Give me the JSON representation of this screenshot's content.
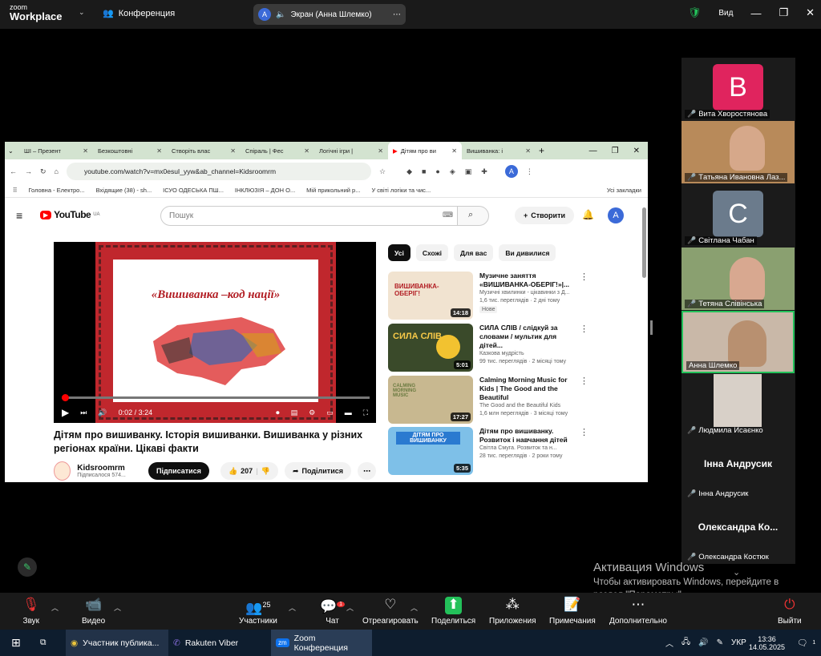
{
  "zoom_top": {
    "logo_top": "zoom",
    "logo_bottom": "Workplace",
    "meeting_label": "Конференция",
    "share_avatar": "A",
    "share_label": "Экран (Анна Шлемко)",
    "view_label": "Вид"
  },
  "browser": {
    "tabs": [
      "ШІ – Презент",
      "Безкоштовні",
      "Створіть влас",
      "Спіраль | Фес",
      "Логічні ігри |",
      "Дітям про ви",
      "Вишиванка: і"
    ],
    "active_tab_index": 5,
    "url": "youtube.com/watch?v=mx0esuI_yyw&ab_channel=Kidsroomrm",
    "bookmarks": [
      "Головна - Електро...",
      "Вхідящие (38) - sh...",
      "ІСУО ОДЕСЬКА ПШ...",
      "ІНКЛЮЗІЯ – ДОН О...",
      "Мій прикольний р...",
      "У світі логіки та чис..."
    ],
    "all_bookmarks": "Усі закладки",
    "profile_letter": "A"
  },
  "youtube": {
    "logo": "YouTube",
    "region": "UA",
    "search_placeholder": "Пошук",
    "create_label": "Створити",
    "avatar_letter": "A",
    "thumbnail_title": "«Вишиванка –код нації»",
    "time_current": "0:02",
    "time_total": "3:24",
    "progress": 0.01,
    "video_title": "Дітям про вишиванку. Історія вишиванки. Вишиванка у різних регіонах країни. Цікаві факти",
    "channel_name": "Kidsroomrm",
    "channel_subs": "Підписалося 574...",
    "subscribe_label": "Підписатися",
    "likes": "207",
    "share_label": "Поділитися",
    "chips": [
      "Усі",
      "Схожі",
      "Для вас",
      "Ви дивилися"
    ],
    "recommendations": [
      {
        "title": "Музичне заняття «ВИШИВАНКА-ОБЕРІГ!»|...",
        "channel": "Музичні хвилинки - цікавинки з Д...",
        "meta": "1,6 тис. переглядів · 2 дні тому",
        "badge": "Нове",
        "duration": "14:18",
        "thumb_text": "ВИШИВАНКА-ОБЕРІГ!",
        "color": "#f1e3d0"
      },
      {
        "title": "СИЛА СЛІВ / слідкуй за словами / мультик для дітей...",
        "channel": "Казкова мудрість",
        "meta": "99 тис. переглядів · 2 місяці тому",
        "badge": "",
        "duration": "5:01",
        "thumb_text": "СИЛА СЛІВ",
        "color": "#3a4a2a"
      },
      {
        "title": "Calming Morning Music for Kids | The Good and the Beautiful",
        "channel": "The Good and the Beautiful Kids",
        "meta": "1,6 млн переглядів · 3 місяці тому",
        "badge": "",
        "duration": "17:27",
        "thumb_text": "CALMING MORNING MUSIC",
        "color": "#c8b890"
      },
      {
        "title": "Дітям про вишиванку. Розвиток і навчання дітей",
        "channel": "Світла Смуга. Розвиток та н...",
        "meta": "28 тис. переглядів · 2 роки тому",
        "badge": "",
        "duration": "5:35",
        "thumb_text": "ДІТЯМ ПРО ВИШИВАНКУ",
        "color": "#7ec0e8"
      }
    ]
  },
  "participants": [
    {
      "name": "Вита Хворостянова",
      "type": "letter",
      "letter": "B",
      "color": "#e0245e"
    },
    {
      "name": "Тaтьяна Ивановна Лаз...",
      "type": "video",
      "color": "#b88a5a"
    },
    {
      "name": "Світлана Чабан",
      "type": "letter",
      "letter": "C",
      "color": "#6b7b8c"
    },
    {
      "name": "Тетяна Слівінська",
      "type": "video",
      "color": "#8aa070"
    },
    {
      "name": "Анна Шлемко",
      "type": "video",
      "color": "#c9b8a8"
    },
    {
      "name": "Людмила Исаєнко",
      "type": "video",
      "color": "#d8d0c8"
    },
    {
      "name": "Інна Андрусик",
      "type": "text",
      "big": "Інна Андрусик"
    },
    {
      "name": "Олександра  Костюк",
      "type": "text",
      "big": "Олександра   Ко..."
    }
  ],
  "activation": {
    "title": "Активация Windows",
    "body": "Чтобы активировать Windows, перейдите в раздел \"Параметры\"."
  },
  "toolbar": {
    "audio": "Звук",
    "video": "Видео",
    "participants": "Участники",
    "participants_count": "25",
    "chat": "Чат",
    "chat_badge": "1",
    "react": "Отреагировать",
    "share": "Поделиться",
    "apps": "Приложения",
    "notes": "Примечания",
    "more": "Дополнительно",
    "leave": "Выйти"
  },
  "taskbar": {
    "chrome_label": "Участник публика...",
    "viber_label": "Rakuten Viber",
    "zoom_label": "Zoom Конференция",
    "lang": "УКР",
    "time": "13:36",
    "date": "14.05.2025",
    "notif_count": "1"
  },
  "colors": {
    "accent_green": "#23c15a",
    "zoom_blue": "#0e72ed",
    "yt_red": "#ff0000"
  }
}
